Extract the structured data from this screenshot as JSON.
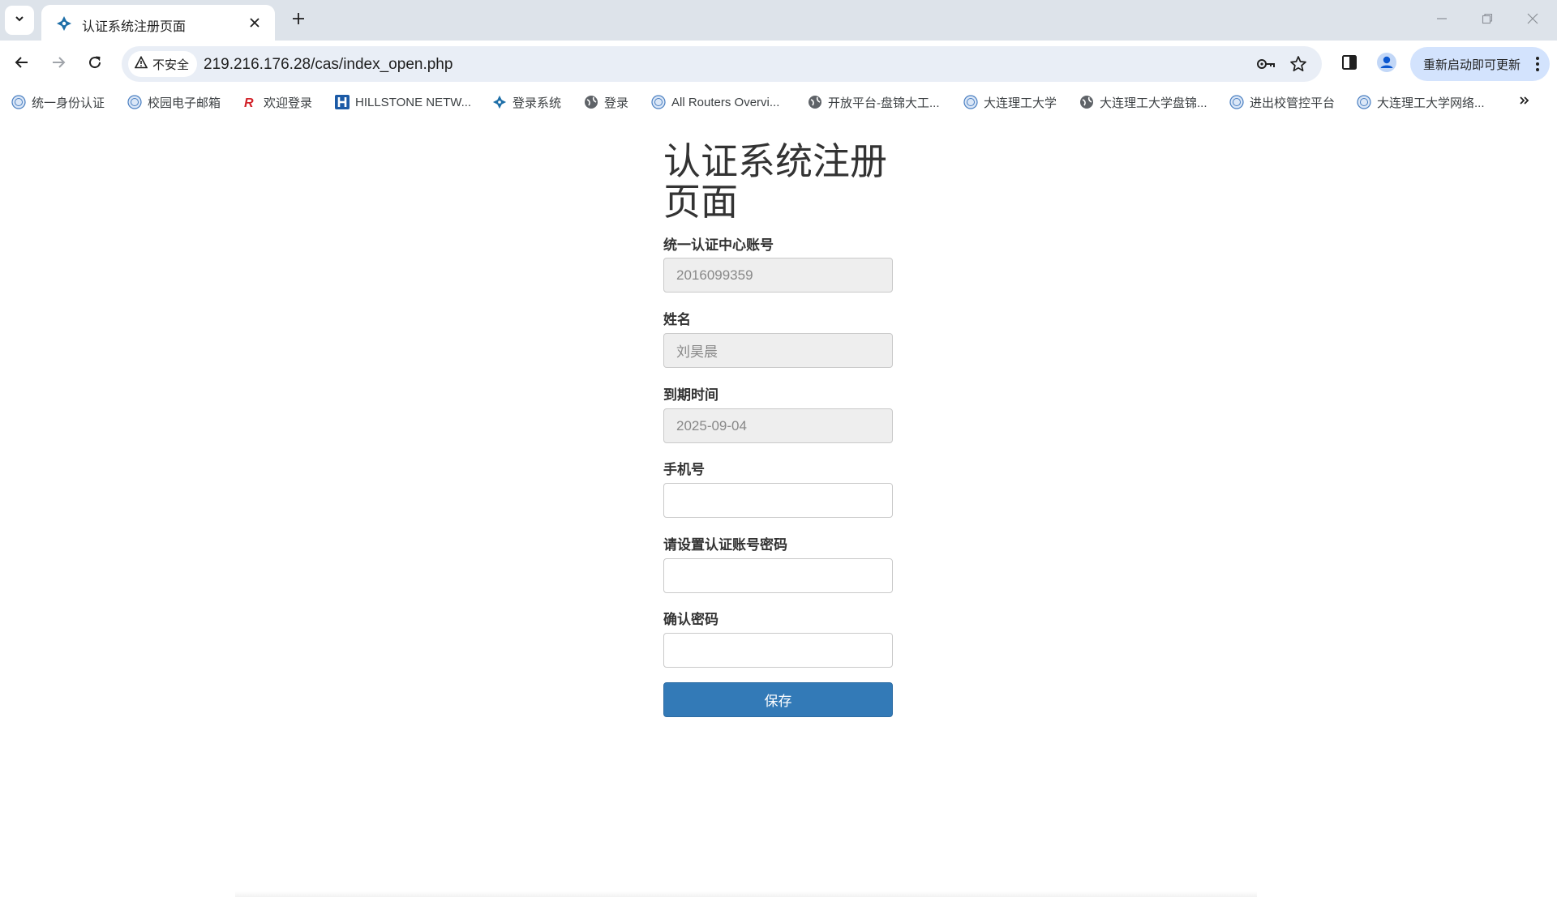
{
  "browser": {
    "tab": {
      "title": "认证系统注册页面",
      "favicon": "diamond-compass-icon"
    },
    "omnibox": {
      "security_label": "不安全",
      "url": "219.216.176.28/cas/index_open.php"
    },
    "update_button_label": "重新启动即可更新",
    "bookmarks": [
      {
        "label": "统一身份认证",
        "icon": "globe-seal-icon"
      },
      {
        "label": "校园电子邮箱",
        "icon": "globe-seal-icon"
      },
      {
        "label": "欢迎登录",
        "icon": "r-logo-icon"
      },
      {
        "label": "HILLSTONE NETW...",
        "icon": "h-logo-icon"
      },
      {
        "label": "登录系统",
        "icon": "diamond-compass-icon"
      },
      {
        "label": "登录",
        "icon": "globe-icon"
      },
      {
        "label": "All Routers Overvi...",
        "icon": "globe-seal-icon"
      },
      {
        "label": "开放平台-盘锦大工...",
        "icon": "globe-icon"
      },
      {
        "label": "大连理工大学",
        "icon": "globe-seal-icon"
      },
      {
        "label": "大连理工大学盘锦...",
        "icon": "globe-icon"
      },
      {
        "label": "进出校管控平台",
        "icon": "globe-seal-icon"
      },
      {
        "label": "大连理工大学网络...",
        "icon": "globe-seal-icon"
      }
    ]
  },
  "form": {
    "title": "认证系统注册页面",
    "fields": [
      {
        "label": "统一认证中心账号",
        "value": "2016099359",
        "placeholder": "",
        "disabled": true
      },
      {
        "label": "姓名",
        "value": "刘昊晨",
        "placeholder": "",
        "disabled": true
      },
      {
        "label": "到期时间",
        "value": "2025-09-04",
        "placeholder": "",
        "disabled": true
      },
      {
        "label": "手机号",
        "value": "",
        "placeholder": "",
        "disabled": false
      },
      {
        "label": "请设置认证账号密码",
        "value": "",
        "placeholder": "",
        "disabled": false
      },
      {
        "label": "确认密码",
        "value": "",
        "placeholder": "",
        "disabled": false
      }
    ],
    "submit_label": "保存"
  },
  "colors": {
    "primary_button": "#337ab7",
    "disabled_input_bg": "#eeeeee",
    "tabstrip_bg": "#dde3ea",
    "update_button_bg": "#d3e3fd"
  }
}
